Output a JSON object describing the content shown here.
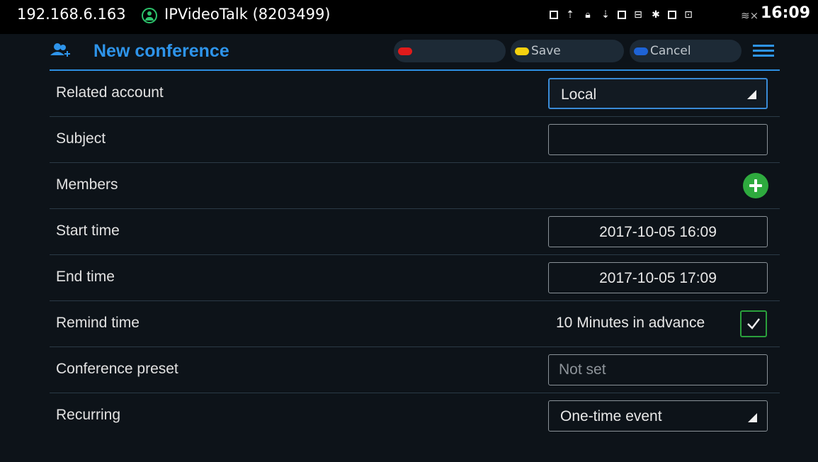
{
  "status_bar": {
    "ip": "192.168.6.163",
    "account": "IPVideoTalk (8203499)",
    "time": "16:09",
    "icons": [
      "image-icon",
      "upload-icon",
      "lock-icon",
      "download-icon",
      "calendar-icon",
      "network-icon",
      "bluetooth-icon",
      "sim-icon",
      "display-icon",
      "wifi-icon"
    ]
  },
  "header": {
    "title": "New conference",
    "red_button_label": "",
    "save_label": "Save",
    "cancel_label": "Cancel",
    "colors": {
      "accent": "#2e94ea",
      "red": "#e01b1b",
      "yellow": "#f5d10f",
      "blue": "#1e63d6"
    }
  },
  "form": {
    "related_account": {
      "label": "Related account",
      "value": "Local"
    },
    "subject": {
      "label": "Subject",
      "value": ""
    },
    "members": {
      "label": "Members"
    },
    "start_time": {
      "label": "Start time",
      "value": "2017-10-05 16:09"
    },
    "end_time": {
      "label": "End time",
      "value": "2017-10-05 17:09"
    },
    "remind_time": {
      "label": "Remind time",
      "value": "10 Minutes in advance",
      "checked": true
    },
    "conference_preset": {
      "label": "Conference preset",
      "placeholder": "Not set"
    },
    "recurring": {
      "label": "Recurring",
      "value": "One-time event"
    }
  }
}
